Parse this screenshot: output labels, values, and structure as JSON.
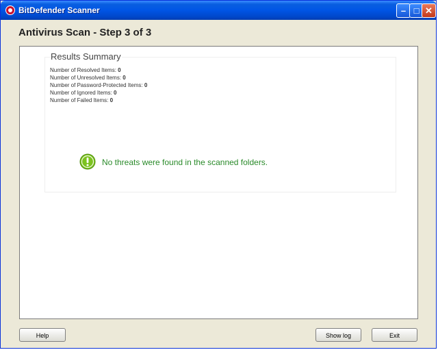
{
  "window": {
    "title": "BitDefender Scanner"
  },
  "titlebar_icons": {
    "app": "bitdefender-logo-icon",
    "minimize": "minimize-icon",
    "maximize": "maximize-icon",
    "close": "close-icon"
  },
  "header": {
    "title": "Antivirus Scan - Step 3 of 3"
  },
  "summary": {
    "title": "Results Summary",
    "stats": [
      {
        "label": "Number of Resolved Items:",
        "value": "0"
      },
      {
        "label": "Number of Unresolved Items:",
        "value": "0"
      },
      {
        "label": "Number of Password-Protected Items:",
        "value": "0"
      },
      {
        "label": "Number of Ignored Items:",
        "value": "0"
      },
      {
        "label": "Number of Failed Items:",
        "value": "0"
      }
    ],
    "status_icon": "success-exclamation-icon",
    "status_text": "No threats were found in the scanned folders."
  },
  "footer": {
    "help_label": "Help",
    "show_log_label": "Show log",
    "exit_label": "Exit"
  },
  "colors": {
    "titlebar": "#0055e5",
    "status_text": "#2a8a2a",
    "status_icon": "#7cc21f",
    "background": "#ece9d8"
  }
}
